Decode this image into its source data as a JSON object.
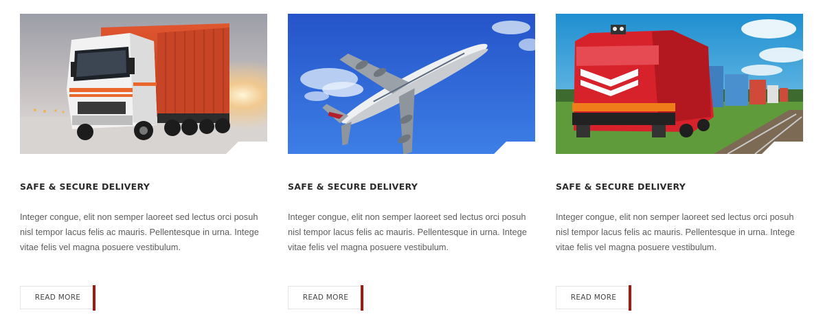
{
  "cards": [
    {
      "image_icon": "truck-image",
      "title": "SAFE & SECURE DELIVERY",
      "text": "Integer congue, elit non semper laoreet sed lectus orci posuh nisl tempor lacus felis ac mauris. Pellentesque in urna. Intege vitae felis vel magna posuere vestibulum.",
      "button": "READ MORE"
    },
    {
      "image_icon": "airplane-image",
      "title": "SAFE & SECURE DELIVERY",
      "text": "Integer congue, elit non semper laoreet sed lectus orci posuh nisl tempor lacus felis ac mauris. Pellentesque in urna. Intege vitae felis vel magna posuere vestibulum.",
      "button": "READ MORE"
    },
    {
      "image_icon": "train-image",
      "title": "SAFE & SECURE DELIVERY",
      "text": "Integer congue, elit non semper laoreet sed lectus orci posuh nisl tempor lacus felis ac mauris. Pellentesque in urna. Intege vitae felis vel magna posuere vestibulum.",
      "button": "READ MORE"
    }
  ],
  "colors": {
    "accent": "#a41a13",
    "title": "#2b2b2b",
    "body_text": "#5c5c5c",
    "button_border": "#e4e4e4"
  }
}
